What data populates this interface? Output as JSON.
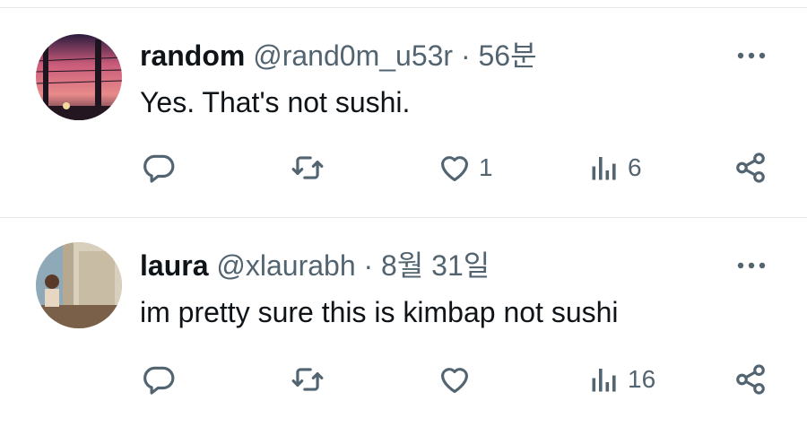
{
  "tweets": [
    {
      "name": "random",
      "handle": "@rand0m_u53r",
      "separator": "·",
      "time": "56분",
      "text": "Yes. That's not sushi.",
      "actions": {
        "replies": "",
        "reposts": "",
        "likes": "1",
        "views": "6"
      }
    },
    {
      "name": "laura",
      "handle": "@xlaurabh",
      "separator": "·",
      "time": "8월 31일",
      "text": "im pretty sure this is kimbap not sushi",
      "actions": {
        "replies": "",
        "reposts": "",
        "likes": "",
        "views": "16"
      }
    }
  ],
  "colors": {
    "text": "#0f1419",
    "secondary": "#536471",
    "divider": "#e6e9ec"
  },
  "icons": [
    "more-icon",
    "reply-icon",
    "repost-icon",
    "like-icon",
    "views-icon",
    "share-icon"
  ]
}
